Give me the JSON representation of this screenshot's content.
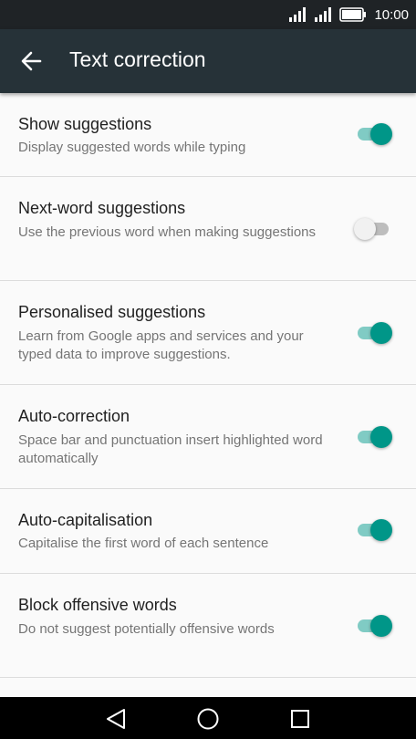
{
  "status_bar": {
    "time": "10:00"
  },
  "app_bar": {
    "title": "Text correction"
  },
  "settings": [
    {
      "title": "Show suggestions",
      "subtitle": "Display suggested words while typing",
      "enabled": true
    },
    {
      "title": "Next-word suggestions",
      "subtitle": "Use the previous word when making suggestions",
      "enabled": false
    },
    {
      "title": "Personalised suggestions",
      "subtitle": "Learn from Google apps and services and your typed data to improve suggestions.",
      "enabled": true
    },
    {
      "title": "Auto-correction",
      "subtitle": "Space bar and punctuation insert highlighted word automatically",
      "enabled": true
    },
    {
      "title": "Auto-capitalisation",
      "subtitle": "Capitalise the first word of each sentence",
      "enabled": true
    },
    {
      "title": "Block offensive words",
      "subtitle": "Do not suggest potentially offensive words",
      "enabled": true
    }
  ],
  "colors": {
    "status_bar": "#1f2326",
    "app_bar": "#263238",
    "accent": "#009688",
    "accent_track": "#80cbc4"
  },
  "icons": {
    "back": "back-arrow-icon",
    "nav_back": "nav-back-icon",
    "nav_home": "nav-home-icon",
    "nav_recents": "nav-recents-icon"
  }
}
